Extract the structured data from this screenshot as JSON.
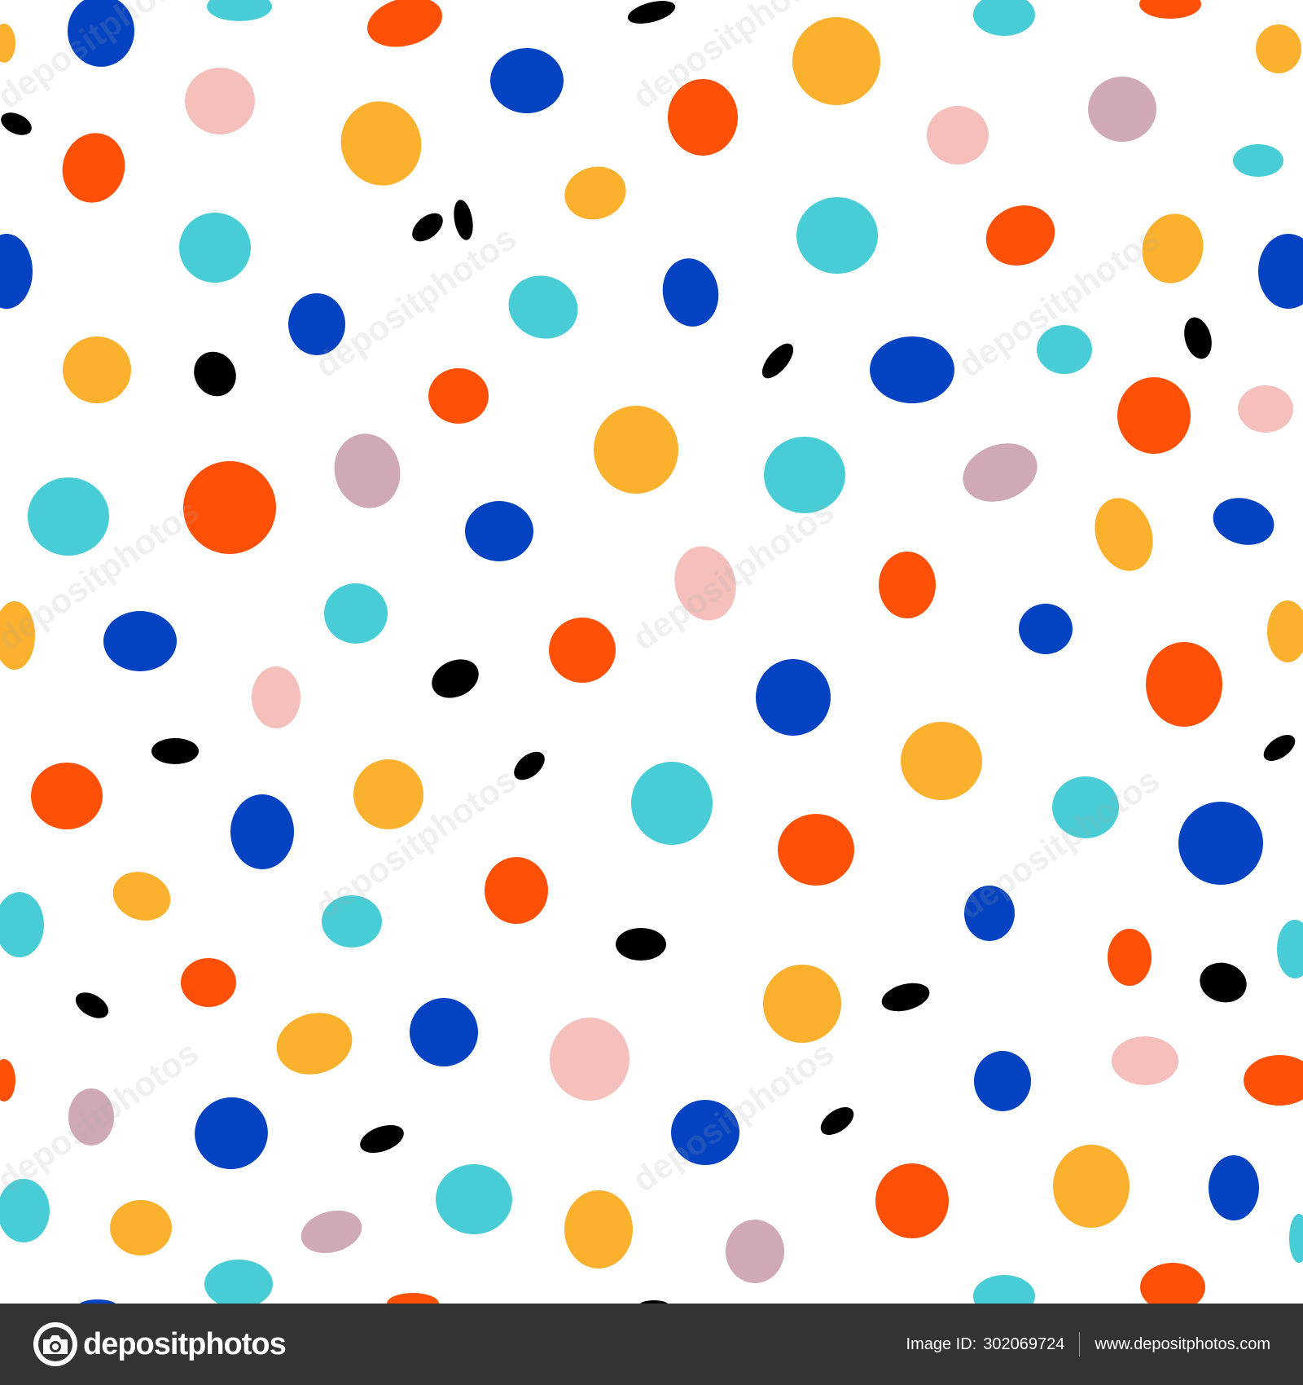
{
  "footer": {
    "brand_name": "depositphotos",
    "image_id_label": "Image ID:",
    "image_id_value": "302069724",
    "site_url": "www.depositphotos.com"
  },
  "watermark": {
    "text": "depositphotos"
  },
  "colors": {
    "background": "#ffffff",
    "footer_bg": "#333333",
    "orange": "#ff5008",
    "yellow": "#fbb02e",
    "blue": "#0342c0",
    "cyan": "#48cdd6",
    "pink": "#f5bfbb",
    "mauve": "#cfa9b6",
    "black": "#000000"
  },
  "icons": {
    "brand_logo": "camera-aperture-icon"
  }
}
